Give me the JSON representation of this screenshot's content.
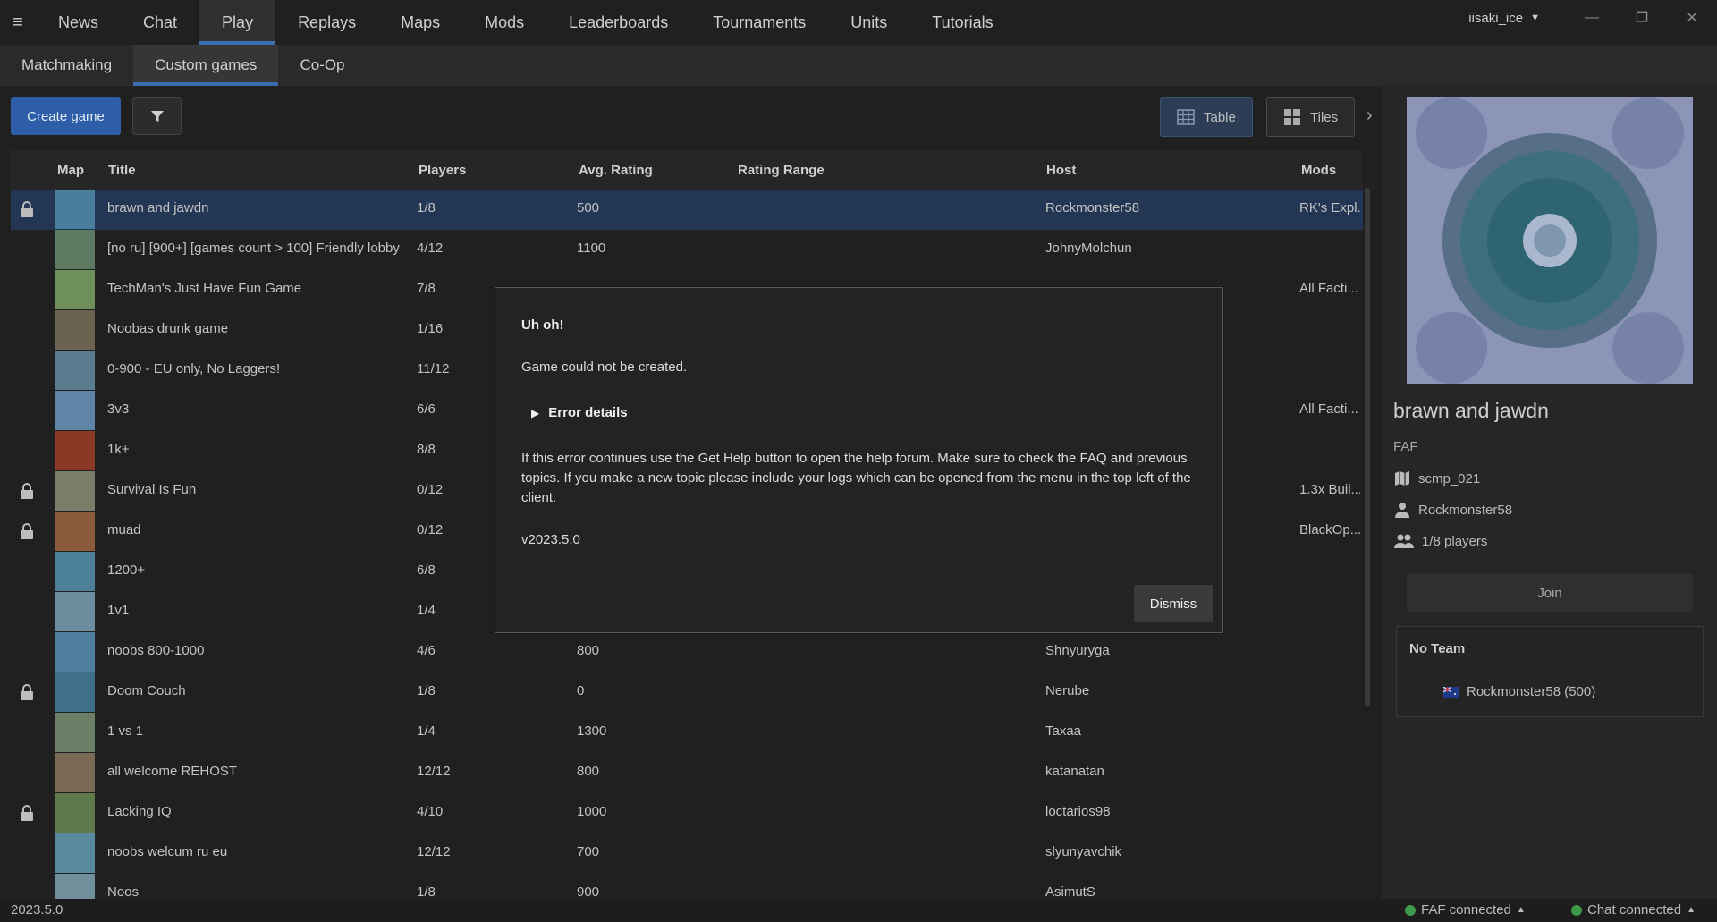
{
  "nav": {
    "tabs": [
      "News",
      "Chat",
      "Play",
      "Replays",
      "Maps",
      "Mods",
      "Leaderboards",
      "Tournaments",
      "Units",
      "Tutorials"
    ],
    "active_tab": "Play",
    "user": "iisaki_ice"
  },
  "subnav": {
    "tabs": [
      "Matchmaking",
      "Custom games",
      "Co-Op"
    ],
    "active_tab": "Custom games"
  },
  "toolbar": {
    "create_label": "Create game",
    "table_label": "Table",
    "tiles_label": "Tiles"
  },
  "table": {
    "headers": {
      "map": "Map",
      "title": "Title",
      "players": "Players",
      "avg": "Avg. Rating",
      "range": "Rating Range",
      "host": "Host",
      "mods": "Mods"
    },
    "rows": [
      {
        "locked": true,
        "title": "brawn and jawdn",
        "players": "1/8",
        "avg": "500",
        "range": "",
        "host": "Rockmonster58",
        "mods": "RK's Expl...",
        "thumb": "#4a7f9c"
      },
      {
        "locked": false,
        "title": "[no ru] [900+] [games count > 100] Friendly lobby",
        "players": "4/12",
        "avg": "1100",
        "range": "",
        "host": "JohnyMolchun",
        "mods": "",
        "thumb": "#5f7a62"
      },
      {
        "locked": false,
        "title": "TechMan's Just Have Fun Game",
        "players": "7/8",
        "avg": "",
        "range": "",
        "host": "",
        "mods": "All Facti...",
        "thumb": "#6e8f5a"
      },
      {
        "locked": false,
        "title": "Noobas drunk game",
        "players": "1/16",
        "avg": "",
        "range": "",
        "host": "",
        "mods": "",
        "thumb": "#6b6250"
      },
      {
        "locked": false,
        "title": "0-900 - EU only, No Laggers!",
        "players": "11/12",
        "avg": "",
        "range": "",
        "host": "",
        "mods": "",
        "thumb": "#5a7c8f"
      },
      {
        "locked": false,
        "title": "3v3",
        "players": "6/6",
        "avg": "",
        "range": "",
        "host": "",
        "mods": "All Facti...",
        "thumb": "#5f86a6"
      },
      {
        "locked": false,
        "title": "1k+",
        "players": "8/8",
        "avg": "",
        "range": "",
        "host": "",
        "mods": "",
        "thumb": "#8a3a24"
      },
      {
        "locked": true,
        "title": "Survival Is Fun",
        "players": "0/12",
        "avg": "",
        "range": "",
        "host": "",
        "mods": "1.3x Buil...",
        "thumb": "#7b7e68"
      },
      {
        "locked": true,
        "title": "muad",
        "players": "0/12",
        "avg": "",
        "range": "",
        "host": "",
        "mods": "BlackOp...",
        "thumb": "#8a5a3a"
      },
      {
        "locked": false,
        "title": "1200+",
        "players": "6/8",
        "avg": "",
        "range": "",
        "host": "",
        "mods": "",
        "thumb": "#4c7f9a"
      },
      {
        "locked": false,
        "title": "1v1",
        "players": "1/4",
        "avg": "",
        "range": "",
        "host": "",
        "mods": "",
        "thumb": "#6d8e9e"
      },
      {
        "locked": false,
        "title": "noobs 800-1000",
        "players": "4/6",
        "avg": "800",
        "range": "",
        "host": "Shnyuryga",
        "mods": "",
        "thumb": "#4f7f9e"
      },
      {
        "locked": true,
        "title": "Doom Couch",
        "players": "1/8",
        "avg": "0",
        "range": "",
        "host": "Nerube",
        "mods": "",
        "thumb": "#3f6f8a"
      },
      {
        "locked": false,
        "title": "1 vs 1",
        "players": "1/4",
        "avg": "1300",
        "range": "",
        "host": "Taxaa",
        "mods": "",
        "thumb": "#6a7f66"
      },
      {
        "locked": false,
        "title": "all welcome REHOST",
        "players": "12/12",
        "avg": "800",
        "range": "",
        "host": "katanatan",
        "mods": "",
        "thumb": "#7a6a55"
      },
      {
        "locked": true,
        "title": "Lacking IQ",
        "players": "4/10",
        "avg": "1000",
        "range": "",
        "host": "loctarios98",
        "mods": "",
        "thumb": "#5e7a4a"
      },
      {
        "locked": false,
        "title": "noobs welcum ru eu",
        "players": "12/12",
        "avg": "700",
        "range": "",
        "host": "slyunyavchik",
        "mods": "",
        "thumb": "#5a8aa0"
      },
      {
        "locked": false,
        "title": "Noos",
        "players": "1/8",
        "avg": "900",
        "range": "",
        "host": "AsimutS",
        "mods": "",
        "thumb": "#6f8f9a"
      }
    ]
  },
  "side": {
    "title": "brawn and jawdn",
    "featured_mod": "FAF",
    "map_name": "scmp_021",
    "host": "Rockmonster58",
    "players": "1/8 players",
    "join_label": "Join",
    "team_title": "No Team",
    "team_player": "Rockmonster58 (500)"
  },
  "dialog": {
    "title": "Uh oh!",
    "message": "Game could not be created.",
    "details_label": "Error details",
    "help_text": "If this error continues use the Get Help button to open the help forum. Make sure to check the FAQ and previous topics. If you make a new topic please include your logs which can be opened from the menu in the top left of the client.",
    "version": "v2023.5.0",
    "dismiss_label": "Dismiss"
  },
  "status": {
    "version": "2023.5.0",
    "faf": "FAF connected",
    "chat": "Chat connected",
    "ok_color": "#3d9a4a"
  }
}
